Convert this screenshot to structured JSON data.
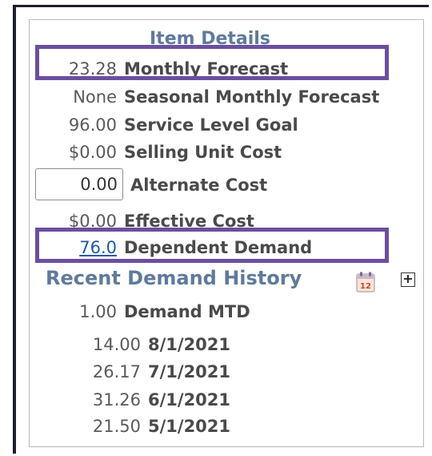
{
  "panel": {
    "title": "Item Details"
  },
  "rows": {
    "monthly_forecast": {
      "value": "23.28",
      "label": "Monthly Forecast"
    },
    "seasonal_forecast": {
      "value": "None",
      "label": "Seasonal Monthly Forecast"
    },
    "service_level": {
      "value": "96.00",
      "label": "Service Level Goal"
    },
    "selling_cost": {
      "value": "$0.00",
      "label": "Selling Unit Cost"
    },
    "alternate_cost": {
      "value": "0.00",
      "label": "Alternate Cost"
    },
    "effective_cost": {
      "value": "$0.00",
      "label": "Effective Cost"
    },
    "dependent_demand": {
      "value": "76.0",
      "label": "Dependent Demand"
    }
  },
  "history": {
    "title": "Recent Demand History",
    "calendar_icon_text": "12",
    "expand_icon": "+",
    "mtd": {
      "value": "1.00",
      "label": "Demand MTD"
    },
    "months": [
      {
        "value": "14.00",
        "date": "8/1/2021"
      },
      {
        "value": "26.17",
        "date": "7/1/2021"
      },
      {
        "value": "31.26",
        "date": "6/1/2021"
      },
      {
        "value": "21.50",
        "date": "5/1/2021"
      }
    ]
  },
  "colors": {
    "highlight": "#6b4fa0",
    "heading": "#5f7a9c",
    "link": "#1f5aa8"
  },
  "icons": {
    "calendar": "calendar-icon",
    "expand": "plus-box-icon"
  }
}
